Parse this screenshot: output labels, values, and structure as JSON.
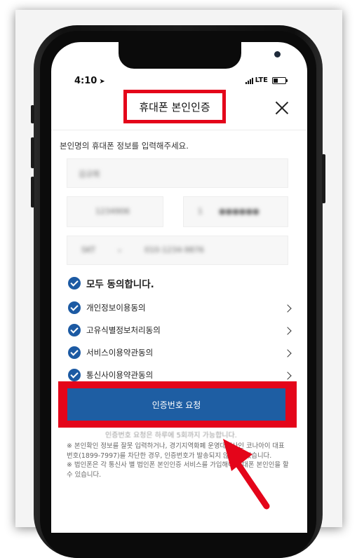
{
  "status_bar": {
    "time": "4:10",
    "network": "LTE"
  },
  "header": {
    "title": "휴대폰 본인인증"
  },
  "form": {
    "instruction": "본인명의 휴대폰 정보를 입력해주세요.",
    "name_value": "김규희",
    "birth_value": "1234906",
    "gender_digit": "1",
    "masked_digits": "●●●●●●",
    "carrier_value": "SKT",
    "phone_value": "010-1234-9876"
  },
  "agreements": {
    "all_label": "모두 동의합니다.",
    "items": [
      {
        "label": "개인정보이용동의"
      },
      {
        "label": "고유식별정보처리동의"
      },
      {
        "label": "서비스이용약관동의"
      },
      {
        "label": "통신사이용약관동의"
      }
    ]
  },
  "request_button": {
    "label": "인증번호 요청"
  },
  "limit_note": "인증번호 요청은 하루에 5회까지 가능합니다.",
  "notes": [
    "※ 본인확인 정보를 잘못 입력하거나, 경기지역화폐 운영대행사인 코나아이 대표번호(1899-7997)를 차단한 경우, 인증번호가 발송되지 않을 수 있습니다.",
    "※ 법인폰은 각 통신사 별 법인폰 본인인증 서비스를 가입해야 휴대폰 본인인을 할 수 있습니다."
  ],
  "colors": {
    "accent_blue": "#1e5ea3",
    "highlight_red": "#e4051a",
    "check_blue": "#1c5aa3"
  }
}
